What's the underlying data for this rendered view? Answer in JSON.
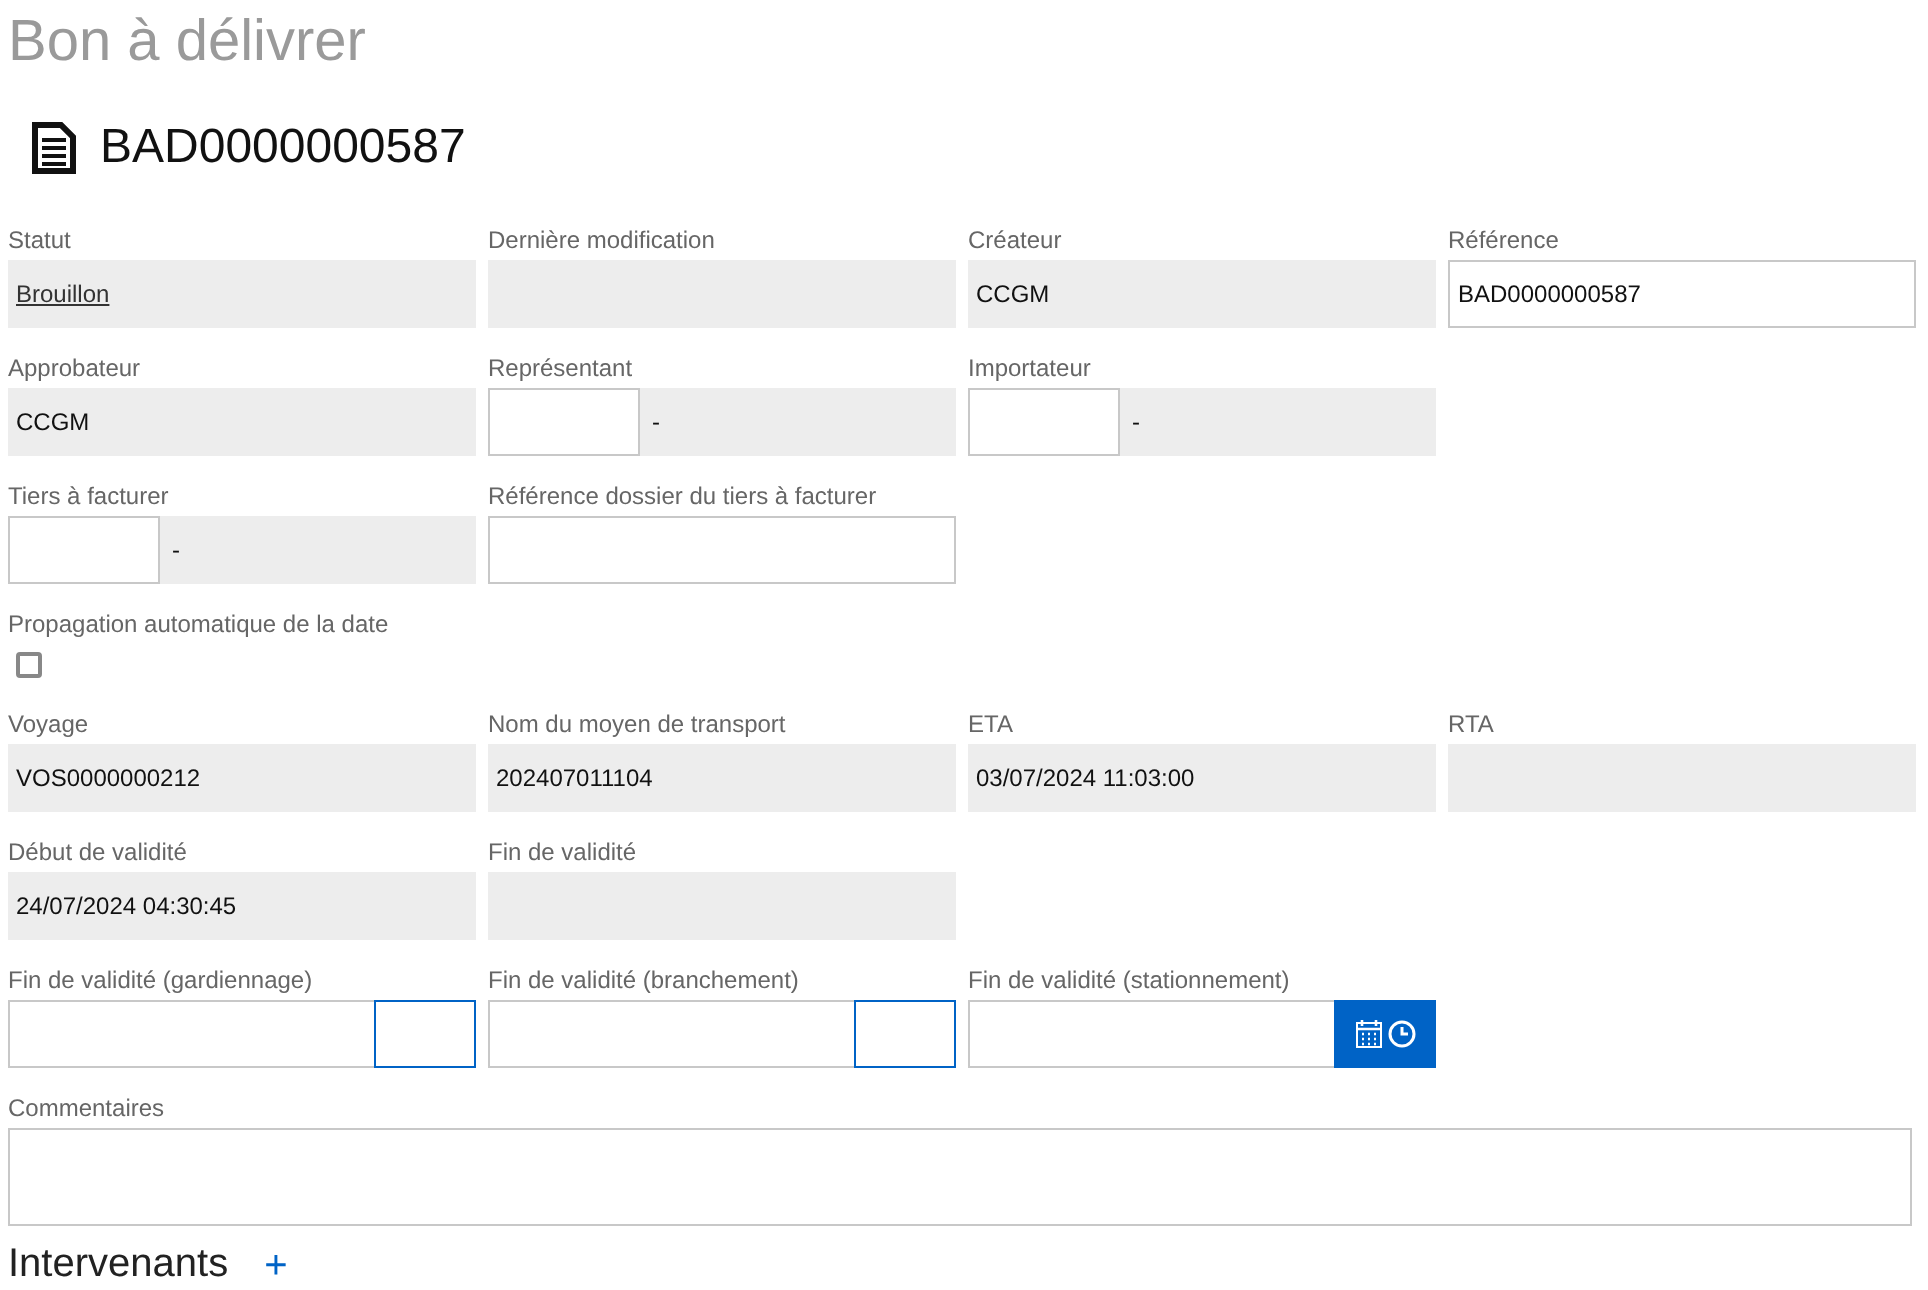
{
  "page_title": "Bon à délivrer",
  "document": {
    "number": "BAD0000000587"
  },
  "rows": [
    [
      {
        "kind": "readonly",
        "label": "Statut",
        "value": "Brouillon",
        "link": true
      },
      {
        "kind": "readonly",
        "label": "Dernière modification"
      },
      {
        "kind": "readonly",
        "label": "Créateur",
        "value": "CCGM",
        "link": false
      },
      {
        "kind": "input",
        "label": "Référence",
        "value": "BAD0000000587"
      }
    ],
    [
      {
        "kind": "readonly",
        "label": "Approbateur",
        "value": "CCGM",
        "link": false
      },
      {
        "kind": "lookup",
        "label": "Représentant",
        "value": "-"
      },
      {
        "kind": "lookup",
        "label": "Importateur",
        "value": "-"
      }
    ],
    [
      {
        "kind": "lookup",
        "label": "Tiers à facturer",
        "value": "-"
      },
      {
        "kind": "input",
        "label": "Référence dossier du tiers à facturer"
      }
    ],
    [
      {
        "kind": "checkbox",
        "label": "Propagation automatique de la date",
        "checked": false
      }
    ],
    [
      {
        "kind": "readonly",
        "label": "Voyage",
        "value": "VOS0000000212",
        "link": false
      },
      {
        "kind": "readonly",
        "label": "Nom du moyen de transport",
        "value": "202407011104",
        "link": false
      },
      {
        "kind": "readonly",
        "label": "ETA",
        "value": "03/07/2024 11:03:00",
        "link": false
      },
      {
        "kind": "readonly",
        "label": "RTA"
      }
    ],
    [
      {
        "kind": "readonly",
        "label": "Début de validité",
        "value": "24/07/2024 04:30:45",
        "link": false
      },
      {
        "kind": "readonly",
        "label": "Fin de validité"
      }
    ],
    [
      {
        "kind": "datetime",
        "label": "Fin de validité (gardiennage)",
        "button_filled": false
      },
      {
        "kind": "datetime",
        "label": "Fin de validité (branchement)",
        "button_filled": false
      },
      {
        "kind": "datetime",
        "label": "Fin de validité (stationnement)",
        "button_filled": true
      }
    ]
  ],
  "comments": {
    "label": "Commentaires"
  },
  "section": {
    "title": "Intervenants",
    "add": "+"
  }
}
